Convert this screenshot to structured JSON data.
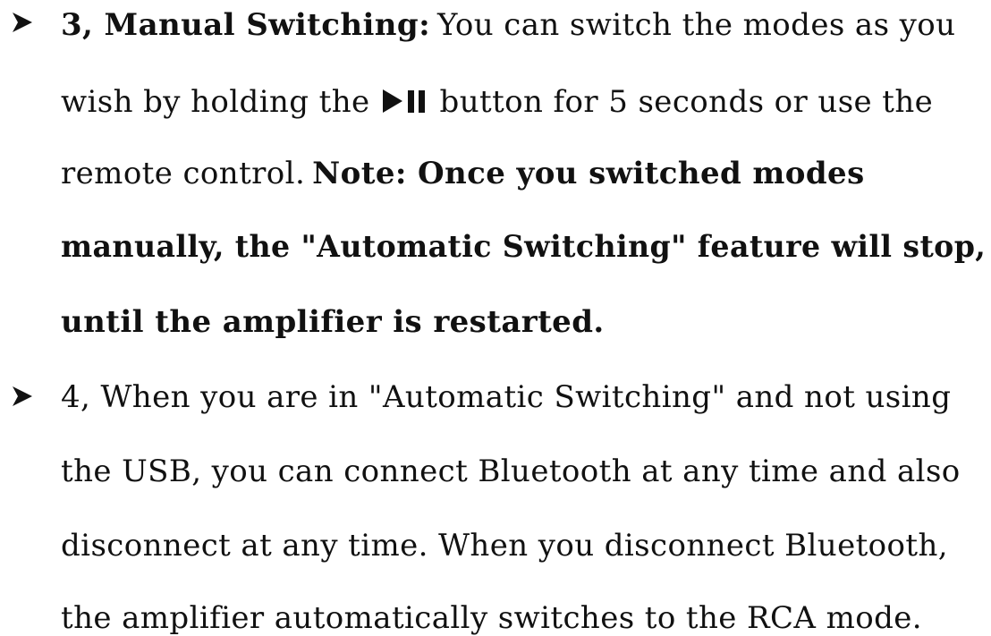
{
  "items": [
    {
      "bullet_icon": "arrowhead-bullet-icon",
      "heading": "3, Manual Switching:",
      "line1_rest": "You can switch the modes as you",
      "line2_before": "wish by holding the",
      "inline_icon": "play-pause-icon",
      "line2_after": "button for 5 seconds or use the",
      "line3_normal": "remote control.",
      "line3_bold": "Note: Once you switched modes",
      "line4": "manually, the \"Automatic Switching\" feature will stop,",
      "line5": "until the amplifier is restarted."
    },
    {
      "bullet_icon": "arrowhead-bullet-icon",
      "line1": "4, When you are in \"Automatic Switching\" and not using",
      "line2": "the USB, you can connect Bluetooth at any time and also",
      "line3": "disconnect at any time. When you disconnect Bluetooth,",
      "line4": "the amplifier automatically switches to the RCA mode."
    }
  ]
}
